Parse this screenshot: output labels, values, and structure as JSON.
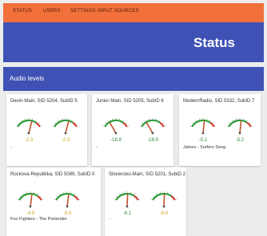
{
  "nav": {
    "items": [
      {
        "label": "STATUS"
      },
      {
        "label": "USERS"
      },
      {
        "label": "SETTINGS"
      },
      {
        "label": "INPUT SOURCES"
      }
    ]
  },
  "header": {
    "title": "Status"
  },
  "section": {
    "title": "Audio levels"
  },
  "colors": {
    "nav": "#f2703a",
    "header": "#3f51b5",
    "needle": "#c0522a",
    "arc_green": "#2e9c3a",
    "arc_red": "#d0392b",
    "value_green": "#2e8b3a",
    "value_yellow": "#c9a514"
  },
  "cards": [
    {
      "title": "Devin-Main, SID 5204, SubID 5",
      "gauges": [
        {
          "value": "-2.3",
          "level": 0.62,
          "tone": "yellow"
        },
        {
          "value": "-2.3",
          "level": 0.62,
          "tone": "yellow"
        }
      ],
      "now_playing": "-"
    },
    {
      "title": "Junior-Main, SID 5205, SubID 6",
      "gauges": [
        {
          "value": "-18.9",
          "level": 0.25,
          "tone": "green"
        },
        {
          "value": "-18.9",
          "level": 0.25,
          "tone": "green"
        }
      ],
      "now_playing": "-"
    },
    {
      "title": "ModernRadio, SID 5332, SubID 7",
      "gauges": [
        {
          "value": "-5.1",
          "level": 0.55,
          "tone": "green"
        },
        {
          "value": "-5.2",
          "level": 0.55,
          "tone": "green"
        }
      ],
      "now_playing": "James - Surfers Song"
    },
    {
      "title": "Rockova-Republika, SID 5089, SubID 0",
      "gauges": [
        {
          "value": "-4.9",
          "level": 0.56,
          "tone": "yellow"
        },
        {
          "value": "-5.0",
          "level": 0.56,
          "tone": "yellow"
        }
      ],
      "now_playing": "Foo Fighters - The Pretender"
    },
    {
      "title": "Slovensko-Main, SID 5201, SubID 2",
      "gauges": [
        {
          "value": "-6.1",
          "level": 0.52,
          "tone": "green"
        },
        {
          "value": "-6.0",
          "level": 0.52,
          "tone": "yellow"
        }
      ],
      "now_playing": "-"
    }
  ]
}
